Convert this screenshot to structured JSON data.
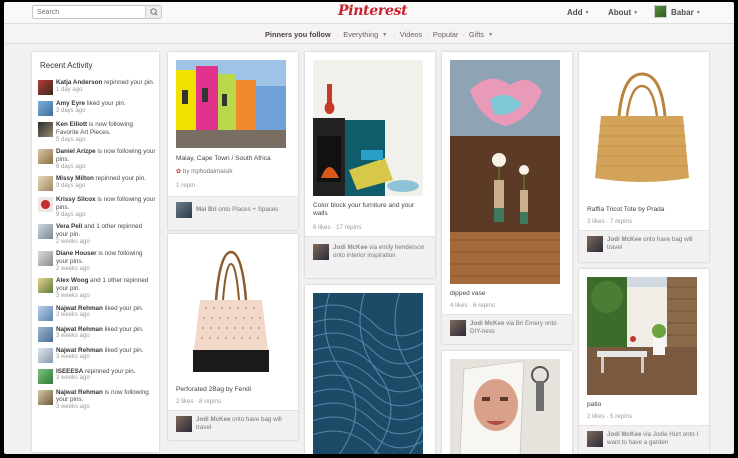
{
  "header": {
    "search_placeholder": "Search",
    "logo": "Pinterest",
    "add_label": "Add",
    "about_label": "About",
    "user_name": "Babar"
  },
  "subnav": {
    "following": "Pinners you follow",
    "everything": "Everything",
    "videos": "Videos",
    "popular": "Popular",
    "gifts": "Gifts",
    "dot": "·"
  },
  "activity": {
    "title": "Recent Activity",
    "items": [
      {
        "name": "Katja Anderson",
        "text": "repinned your pin.",
        "time": "1 day ago"
      },
      {
        "name": "Amy Eyre",
        "text": "liked your pin.",
        "time": "3 days ago"
      },
      {
        "name": "Ken Elliott",
        "text": "is now following Favorite Art Pieces.",
        "time": "5 days ago"
      },
      {
        "name": "Daniel Arizpe",
        "text": "is now following your pins.",
        "time": "6 days ago"
      },
      {
        "name": "Missy Milton",
        "text": "repinned your pin.",
        "time": "9 days ago"
      },
      {
        "name": "Krissy Silcox",
        "text": "is now following your pins.",
        "time": "9 days ago"
      },
      {
        "name": "Vera Pell",
        "text": "and 1 other repinned your pin.",
        "time": "2 weeks ago"
      },
      {
        "name": "Diane Houser",
        "text": "is now following your pins.",
        "time": "2 weeks ago"
      },
      {
        "name": "Alex Woog",
        "text": "and 1 other repinned your pin.",
        "time": "3 weeks ago"
      },
      {
        "name": "Najwat Rehman",
        "text": "liked your pin.",
        "time": "3 weeks ago"
      },
      {
        "name": "Najwat Rehman",
        "text": "liked your pin.",
        "time": "3 weeks ago"
      },
      {
        "name": "Najwat Rehman",
        "text": "liked your pin.",
        "time": "3 weeks ago"
      },
      {
        "name": "ISEEESA",
        "text": "repinned your pin.",
        "time": "3 weeks ago"
      },
      {
        "name": "Najwat Rehman",
        "text": "is now following your pins.",
        "time": "3 weeks ago"
      }
    ]
  },
  "pins": {
    "capetown": {
      "desc": "Malay, Cape Town / South Africa",
      "source": "by mphodaimaisik",
      "stats": "1 repin",
      "pinner": "Mai Bri",
      "board": "onto Places + Spaces"
    },
    "colorblock": {
      "desc": "Color block your furniture and your walls",
      "stats": "6 likes · 17 repins",
      "pinner": "Jodi McKee",
      "via": "via emily henderson",
      "board": "onto interior inspiration"
    },
    "dipped": {
      "desc": "dipped vase",
      "stats": "4 likes · 6 repins",
      "pinner": "Jodi McKee",
      "via": "via Bri Emery",
      "board": "onto DIY-ness"
    },
    "raffia": {
      "desc": "Raffia Tricot Tote by Prada",
      "stats": "3 likes · 7 repins",
      "pinner": "Jodi McKee",
      "board": "onto have bag will travel"
    },
    "perforated": {
      "desc": "Perforated 2Bag by Fendi",
      "stats": "2 likes · 8 repins",
      "pinner": "Jodi McKee",
      "board": "onto have bag will travel"
    },
    "patio": {
      "desc": "patio",
      "stats": "2 likes · 5 repins",
      "pinner": "Jodi McKee",
      "via": "via Jodie Hurt",
      "board": "onto I want to have a garden"
    }
  }
}
